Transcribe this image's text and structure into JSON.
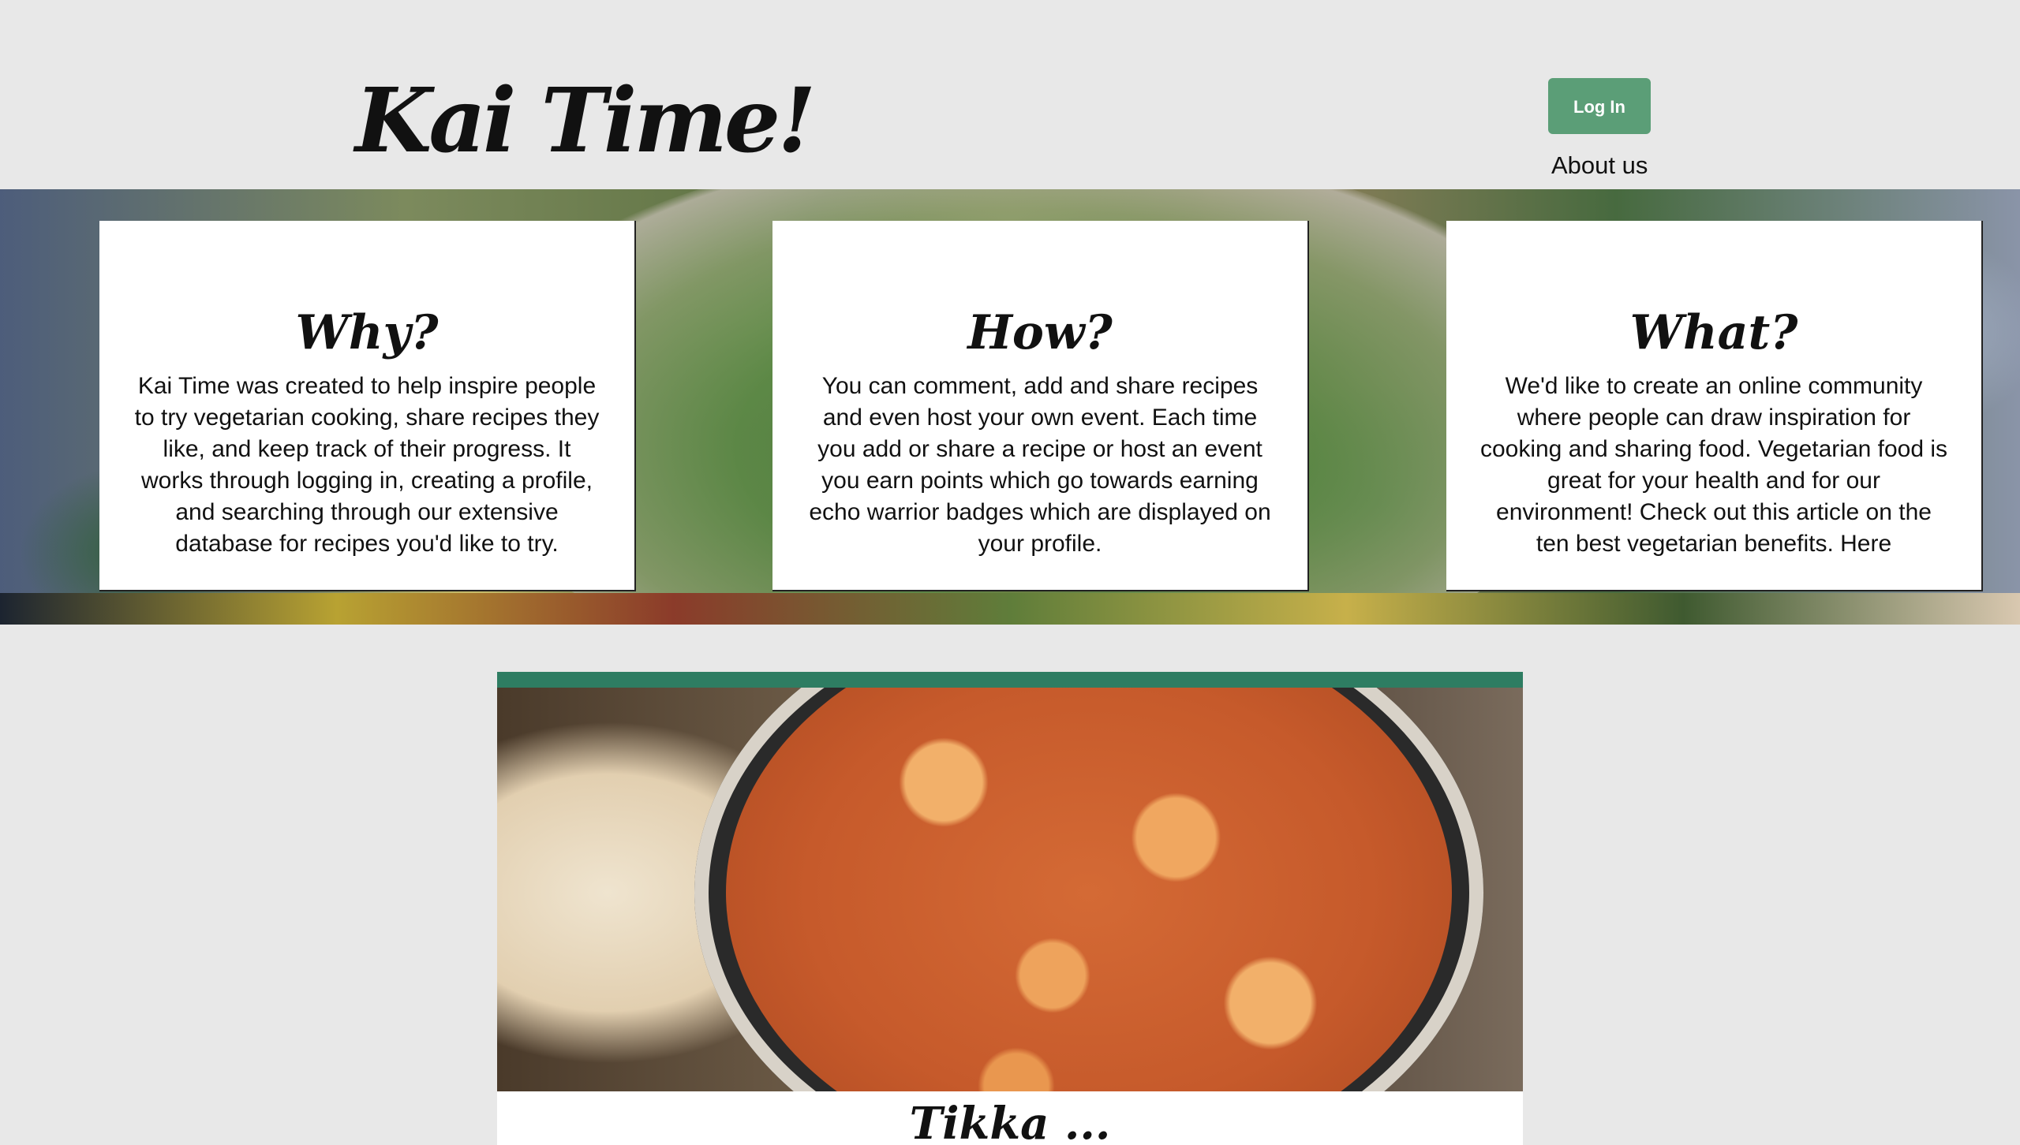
{
  "header": {
    "site_title": "Kai Time!",
    "login_label": "Log In",
    "about_label": "About us"
  },
  "cards": [
    {
      "heading": "Why?",
      "body": "Kai Time was created to help inspire people to try vegetarian cooking, share recipes they like, and keep track of their progress. It works through logging in, creating a profile, and searching through our extensive database for recipes you'd like to try."
    },
    {
      "heading": "How?",
      "body": "You can comment, add and share recipes and even host your own event. Each time you add or share a recipe or host an event you earn points which go towards earning echo warrior badges which are displayed on your profile."
    },
    {
      "heading": "What?",
      "body": "We'd like to create an online community where people can draw inspiration for cooking and sharing food. Vegetarian food is great for your health and for our environment! Check out this article on the ten best vegetarian benefits. Here"
    }
  ],
  "featured_recipe": {
    "title": "Tikka ..."
  },
  "colors": {
    "page_background": "#e8e8e8",
    "login_button": "#5b9e77",
    "recipe_accent": "#2e7d62"
  }
}
